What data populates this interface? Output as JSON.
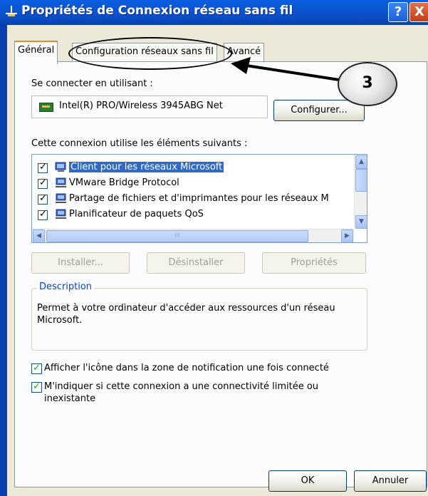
{
  "window": {
    "title": "Propriétés de Connexion réseau sans fil",
    "help_label": "?",
    "close_label": "X"
  },
  "tabs": [
    {
      "label": "Général",
      "active": true
    },
    {
      "label": "Configuration réseaux sans fil",
      "active": false
    },
    {
      "label": "Avancé",
      "active": false
    }
  ],
  "annotation": {
    "callout_number": "3"
  },
  "connect": {
    "heading": "Se connecter en utilisant :",
    "adapter_name": "Intel(R) PRO/Wireless 3945ABG Net",
    "configure_label": "Configurer..."
  },
  "components": {
    "heading": "Cette connexion utilise les éléments suivants :",
    "items": [
      {
        "label": "Client pour les réseaux Microsoft",
        "checked": true,
        "selected": true
      },
      {
        "label": "VMware Bridge Protocol",
        "checked": true,
        "selected": false
      },
      {
        "label": "Partage de fichiers et d'imprimantes pour les réseaux M",
        "checked": true,
        "selected": false
      },
      {
        "label": "Planificateur de paquets QoS",
        "checked": true,
        "selected": false
      }
    ],
    "scroll_grip": "III"
  },
  "buttons": {
    "install": "Installer...",
    "uninstall": "Désinstaller",
    "properties": "Propriétés"
  },
  "description": {
    "legend": "Description",
    "text": "Permet à votre ordinateur d'accéder aux ressources d'un réseau Microsoft."
  },
  "options": [
    {
      "label": "Afficher l'icône dans la zone de notification une fois connecté",
      "checked": true
    },
    {
      "label": "M'indiquer si cette connexion a une connectivité limitée ou inexistante",
      "checked": true
    }
  ],
  "footer": {
    "ok_label": "OK",
    "cancel_label": "Annuler"
  },
  "colors": {
    "title_bar": "#0a5ee0",
    "selection": "#316ac5",
    "legend": "#0046d5",
    "check_green": "#21a121"
  }
}
